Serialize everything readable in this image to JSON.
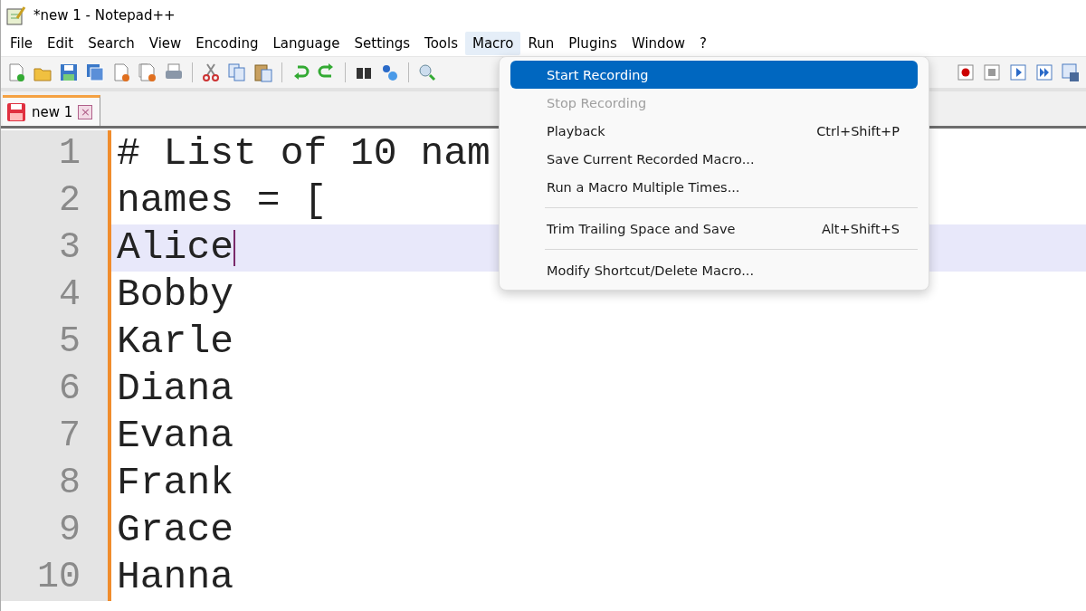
{
  "window": {
    "title": "*new 1 - Notepad++"
  },
  "menu_bar": [
    {
      "label": "File",
      "selected": false
    },
    {
      "label": "Edit",
      "selected": false
    },
    {
      "label": "Search",
      "selected": false
    },
    {
      "label": "View",
      "selected": false
    },
    {
      "label": "Encoding",
      "selected": false
    },
    {
      "label": "Language",
      "selected": false
    },
    {
      "label": "Settings",
      "selected": false
    },
    {
      "label": "Tools",
      "selected": false
    },
    {
      "label": "Macro",
      "selected": true
    },
    {
      "label": "Run",
      "selected": false
    },
    {
      "label": "Plugins",
      "selected": false
    },
    {
      "label": "Window",
      "selected": false
    },
    {
      "label": "?",
      "selected": false
    }
  ],
  "tabs": [
    {
      "label": "new 1",
      "selected": true,
      "close": "×"
    }
  ],
  "editor": {
    "lines": [
      {
        "number": "1",
        "text": "# List of 10 nam",
        "current": false
      },
      {
        "number": "2",
        "text": "names = [",
        "current": false
      },
      {
        "number": "3",
        "text": "Alice",
        "current": true
      },
      {
        "number": "4",
        "text": "Bobby",
        "current": false
      },
      {
        "number": "5",
        "text": "Karle",
        "current": false
      },
      {
        "number": "6",
        "text": "Diana",
        "current": false
      },
      {
        "number": "7",
        "text": "Evana",
        "current": false
      },
      {
        "number": "8",
        "text": "Frank",
        "current": false
      },
      {
        "number": "9",
        "text": "Grace",
        "current": false
      },
      {
        "number": "10",
        "text": "Hanna",
        "current": false
      }
    ]
  },
  "macro_menu": [
    {
      "kind": "item",
      "label": "Start Recording",
      "selected": true,
      "disabled": false
    },
    {
      "kind": "item",
      "label": "Stop Recording",
      "selected": false,
      "disabled": true
    },
    {
      "kind": "item",
      "label": "Playback",
      "shortcut": "Ctrl+Shift+P",
      "selected": false,
      "disabled": false
    },
    {
      "kind": "item",
      "label": "Save Current Recorded Macro...",
      "selected": false,
      "disabled": false
    },
    {
      "kind": "item",
      "label": "Run a Macro Multiple Times...",
      "selected": false,
      "disabled": false
    },
    {
      "kind": "separator"
    },
    {
      "kind": "item",
      "label": "Trim Trailing Space and Save",
      "shortcut": "Alt+Shift+S",
      "selected": false,
      "disabled": false
    },
    {
      "kind": "separator"
    },
    {
      "kind": "item",
      "label": "Modify Shortcut/Delete Macro...",
      "selected": false,
      "disabled": false
    }
  ]
}
